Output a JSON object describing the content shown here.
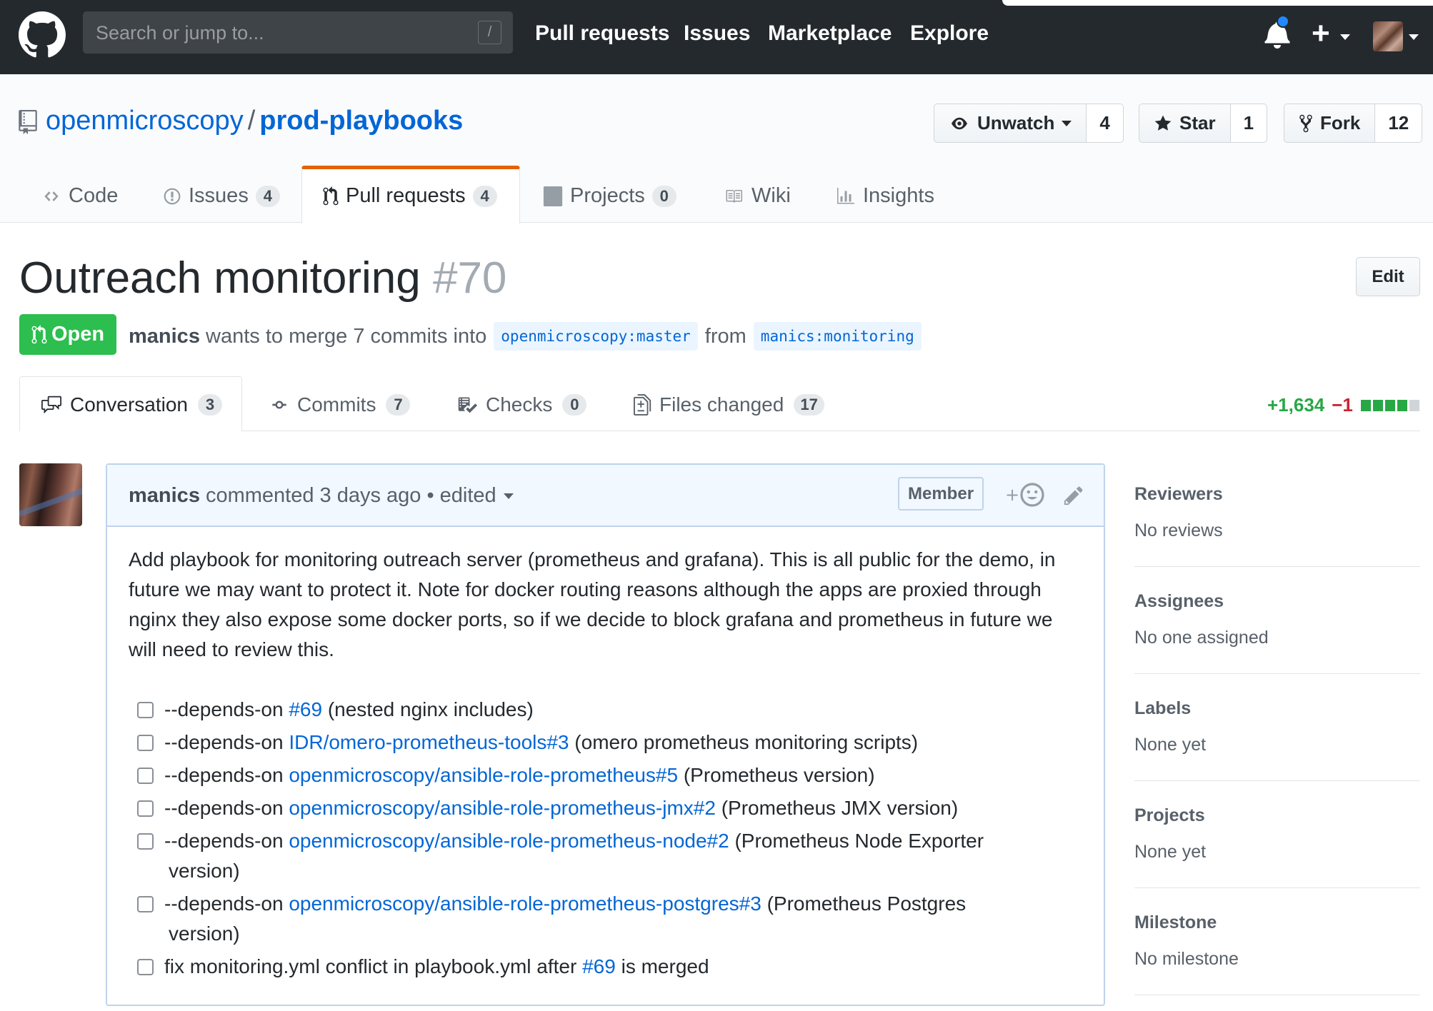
{
  "header": {
    "search_placeholder": "Search or jump to...",
    "search_key": "/",
    "nav": [
      "Pull requests",
      "Issues",
      "Marketplace",
      "Explore"
    ]
  },
  "repo": {
    "owner": "openmicroscopy",
    "separator": "/",
    "name": "prod-playbooks",
    "watch_label": "Unwatch",
    "watch_count": "4",
    "star_label": "Star",
    "star_count": "1",
    "fork_label": "Fork",
    "fork_count": "12"
  },
  "repo_tabs": {
    "code": "Code",
    "issues": "Issues",
    "issues_count": "4",
    "pulls": "Pull requests",
    "pulls_count": "4",
    "projects": "Projects",
    "projects_count": "0",
    "wiki": "Wiki",
    "insights": "Insights"
  },
  "pr": {
    "title": "Outreach monitoring",
    "number": "#70",
    "edit_label": "Edit",
    "state": "Open",
    "author": "manics",
    "merge_text": "wants to merge 7 commits into",
    "base_branch": "openmicroscopy:master",
    "from_text": "from",
    "head_branch": "manics:monitoring"
  },
  "pr_tabs": {
    "conversation": "Conversation",
    "conversation_count": "3",
    "commits": "Commits",
    "commits_count": "7",
    "checks": "Checks",
    "checks_count": "0",
    "files": "Files changed",
    "files_count": "17",
    "additions": "+1,634",
    "deletions": "−1"
  },
  "comment": {
    "author": "manics",
    "action": "commented 3 days ago • edited",
    "role_badge": "Member",
    "body": "Add playbook for monitoring outreach server (prometheus and grafana). This is all public for the demo, in future we may want to protect it. Note for docker routing reasons although the apps are proxied through nginx they also expose some docker ports, so if we decide to block grafana and prometheus in future we will need to review this.",
    "tasks": [
      {
        "prefix": "--depends-on ",
        "link": "#69",
        "suffix": " (nested nginx includes)"
      },
      {
        "prefix": "--depends-on ",
        "link": "IDR/omero-prometheus-tools#3",
        "suffix": " (omero prometheus monitoring scripts)"
      },
      {
        "prefix": "--depends-on ",
        "link": "openmicroscopy/ansible-role-prometheus#5",
        "suffix": " (Prometheus version)"
      },
      {
        "prefix": "--depends-on ",
        "link": "openmicroscopy/ansible-role-prometheus-jmx#2",
        "suffix": " (Prometheus JMX version)"
      },
      {
        "prefix": "--depends-on ",
        "link": "openmicroscopy/ansible-role-prometheus-node#2",
        "suffix": " (Prometheus Node Exporter",
        "cont": "version)"
      },
      {
        "prefix": "--depends-on ",
        "link": "openmicroscopy/ansible-role-prometheus-postgres#3",
        "suffix": " (Prometheus Postgres",
        "cont": "version)"
      },
      {
        "prefix": "fix monitoring.yml conflict in playbook.yml after ",
        "link": "#69",
        "suffix": " is merged"
      }
    ]
  },
  "sidebar": {
    "reviewers": {
      "title": "Reviewers",
      "value": "No reviews"
    },
    "assignees": {
      "title": "Assignees",
      "value": "No one assigned"
    },
    "labels": {
      "title": "Labels",
      "value": "None yet"
    },
    "projects": {
      "title": "Projects",
      "value": "None yet"
    },
    "milestone": {
      "title": "Milestone",
      "value": "No milestone"
    }
  },
  "colors": {
    "header_bg": "#24292e",
    "link": "#0366d6",
    "open_green": "#2cbe4e",
    "active_tab_accent": "#e36209",
    "additions": "#28a745",
    "deletions": "#cb2431"
  },
  "diff_blocks": {
    "green": 4,
    "neutral": 1
  }
}
